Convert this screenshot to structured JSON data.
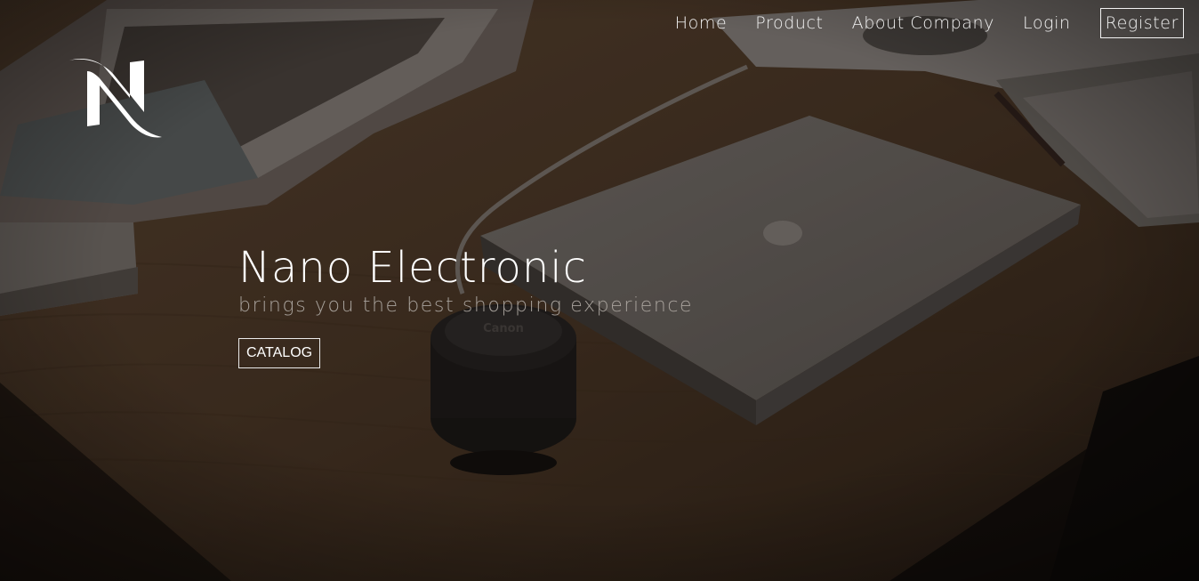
{
  "nav": {
    "items": [
      {
        "label": "Home"
      },
      {
        "label": "Product"
      },
      {
        "label": "About Company"
      },
      {
        "label": "Login"
      }
    ],
    "register_label": "Register"
  },
  "logo": {
    "icon": "n-swoosh-logo"
  },
  "hero": {
    "title": "Nano Electronic",
    "subtitle": "brings you the best shopping experience",
    "cta_label": "CATALOG"
  },
  "colors": {
    "text": "#ffffff",
    "subtitle": "#a8a29c",
    "overlay": "#1a1512"
  }
}
